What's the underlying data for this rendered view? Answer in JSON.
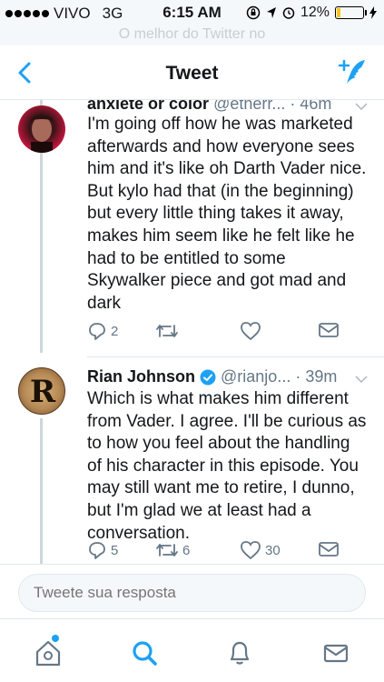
{
  "status_bar": {
    "carrier": "VIVO",
    "network": "3G",
    "time": "6:15 AM",
    "battery": "12%"
  },
  "banner": "O melhor do Twitter no",
  "nav": {
    "title": "Tweet"
  },
  "tweets": [
    {
      "name": "anxiete or color",
      "handle": "@etherr...",
      "time": "· 46m",
      "text": "I'm going off how he was marketed afterwards and how everyone sees him and it's like oh Darth Vader nice. But kylo had that (in the beginning) but every little thing takes it away, makes him seem like he felt like he had to be entitled to some Skywalker piece and got mad and dark",
      "replies": "2",
      "retweets": "",
      "likes": ""
    },
    {
      "name": "Rian Johnson",
      "handle": "@rianjo...",
      "time": "· 39m",
      "verified": true,
      "text": "Which is what makes him different from Vader. I agree. I'll be curious as to how you feel about the handling of his character in this episode. You may still want me to retire, I dunno, but I'm glad we at least had a conversation.",
      "replies": "5",
      "retweets": "6",
      "likes": "30",
      "avatar_letter": "R"
    }
  ],
  "reply_box": {
    "placeholder": "Tweete sua resposta"
  },
  "tabs": [
    "home-icon",
    "search-icon",
    "notifications-icon",
    "messages-icon"
  ],
  "colors": {
    "accent": "#1da1f2",
    "muted": "#657786",
    "verified": "#1da1f2"
  }
}
